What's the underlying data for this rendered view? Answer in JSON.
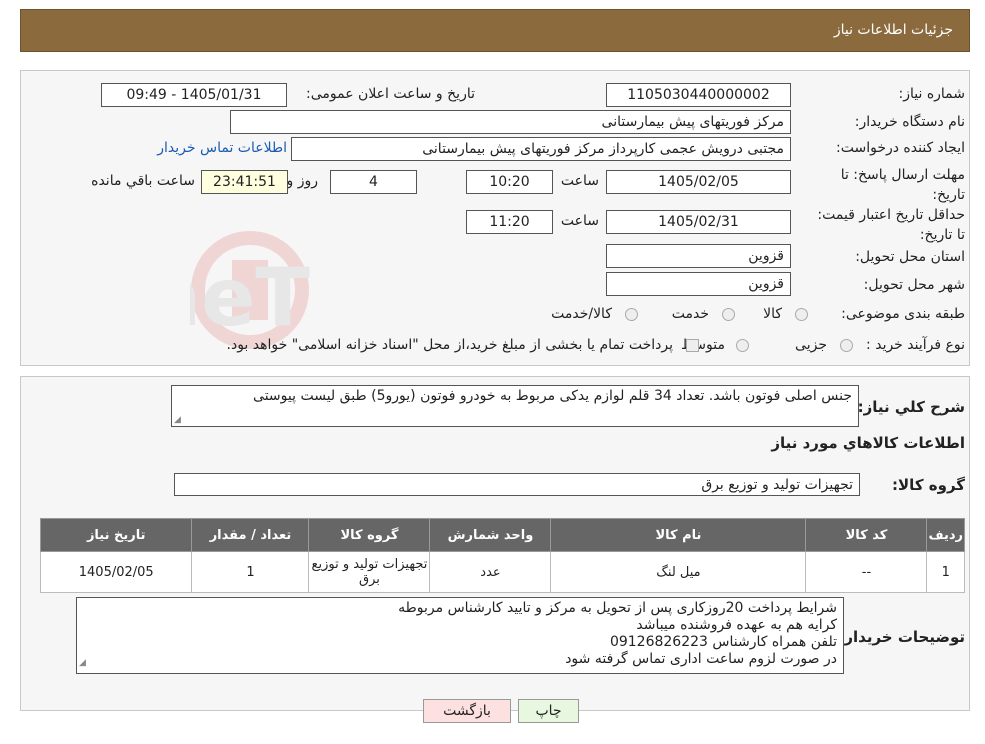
{
  "header": {
    "title": "جزئیات اطلاعات نیاز"
  },
  "form": {
    "need_number_label": "شماره نیاز:",
    "need_number": "1105030440000002",
    "announce_label": "تاریخ و ساعت اعلان عمومی:",
    "announce_value": "1405/01/31 - 09:49",
    "buyer_org_label": "نام دستگاه خریدار:",
    "buyer_org": "مرکز فوریتهای پیش بیمارستانی",
    "creator_label": "ایجاد کننده درخواست:",
    "creator": "مجتبی درویش عجمی کارپرداز مرکز فوریتهای پیش بیمارستانی",
    "contact_link": "اطلاعات تماس خریدار",
    "deadline_label": "مهلت ارسال پاسخ: تا تاریخ:",
    "deadline_date": "1405/02/05",
    "time_label": "ساعت",
    "deadline_time": "10:20",
    "days_value": "4",
    "days_label": "روز و",
    "remaining_time": "23:41:51",
    "remaining_label": "ساعت باقي مانده",
    "validity_label": "حداقل تاریخ اعتبار قیمت: تا تاریخ:",
    "validity_date": "1405/02/31",
    "validity_time": "11:20",
    "province_label": "استان محل تحویل:",
    "province": "قزوین",
    "city_label": "شهر محل تحویل:",
    "city": "قزوین",
    "category_label": "طبقه بندی موضوعی:",
    "category_options": [
      "کالا",
      "خدمت",
      "کالا/خدمت"
    ],
    "process_label": "نوع فرآیند خرید :",
    "process_options": [
      "جزیی",
      "متوسط"
    ],
    "payment_note": "پرداخت تمام یا بخشی از مبلغ خرید،از محل \"اسناد خزانه اسلامی\" خواهد بود."
  },
  "description": {
    "label": "شرح کلي نياز:",
    "text": "جنس اصلی فوتون باشد. تعداد 34 قلم لوازم یدکی مربوط به خودرو فوتون (یورو5) طبق لیست پیوستی"
  },
  "goods_section": {
    "title": "اطلاعات کالاهاي مورد نياز",
    "group_label": "گروه کالا:",
    "group_value": "تجهیزات تولید و توزیع برق"
  },
  "table": {
    "headers": [
      "رديف",
      "کد کالا",
      "نام کالا",
      "واحد شمارش",
      "گروه کالا",
      "تعداد / مقدار",
      "تاريخ نياز"
    ],
    "rows": [
      [
        "1",
        "--",
        "میل لنگ",
        "عدد",
        "تجهیزات تولید و توزیع برق",
        "1",
        "1405/02/05"
      ]
    ]
  },
  "buyer_notes": {
    "label": "توضیحات خریدار:",
    "lines": [
      "شرایط پرداخت 20روزکاری پس از تحویل به مرکز و تایید کارشناس مربوطه",
      "کرایه هم به عهده فروشنده میباشد",
      "تلفن همراه کارشناس 09126826223",
      "در صورت لزوم ساعت اداری تماس گرفته شود"
    ]
  },
  "buttons": {
    "print": "چاپ",
    "back": "بازگشت"
  },
  "watermark": {
    "text": "AriaTender.neT"
  }
}
